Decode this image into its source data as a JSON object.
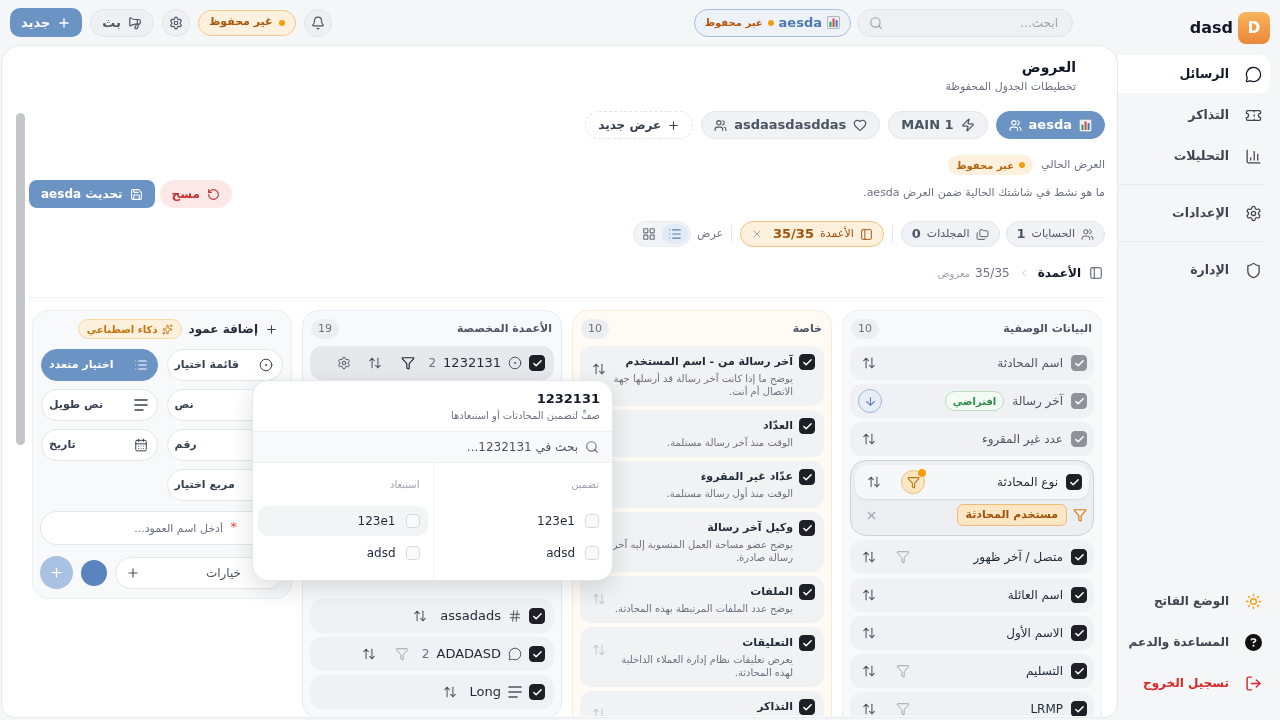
{
  "sidebar": {
    "brand": {
      "initial": "D",
      "name": "dasd"
    },
    "nav_groups": [
      {
        "items": [
          {
            "kind": "messages",
            "label": "الرسائل",
            "selected": true
          },
          {
            "kind": "tickets",
            "label": "التذاكر",
            "selected": false
          },
          {
            "kind": "analytics",
            "label": "التحليلات",
            "selected": false
          }
        ]
      },
      {
        "items": [
          {
            "kind": "settings",
            "label": "الإعدادات",
            "selected": false
          }
        ]
      },
      {
        "items": [
          {
            "kind": "admin",
            "label": "الإدارة",
            "selected": false
          }
        ]
      }
    ],
    "footer": [
      {
        "kind": "theme",
        "label": "الوضع الفاتح"
      },
      {
        "kind": "help",
        "label": "المساعدة والدعم"
      },
      {
        "kind": "logout",
        "label": "تسجيل الخروج"
      }
    ]
  },
  "topbar": {
    "search": {
      "placeholder": "ابحث..."
    },
    "view_chip": {
      "name": "aesda",
      "status": "غير محفوظ"
    },
    "status_badge": "غير محفوظ",
    "broadcast_button": "بث",
    "new_button": "جديد"
  },
  "views_panel": {
    "title": "العروض",
    "subtitle": "تخطيطات الجدول المحفوظة",
    "tabs": [
      {
        "kind": "chart",
        "label": "aesda",
        "shared": true,
        "selected": true
      },
      {
        "kind": "bolt",
        "label": "MAIN 1",
        "shared": false,
        "selected": false
      },
      {
        "kind": "heart",
        "label": "asdaasdasddas",
        "shared": true,
        "selected": false
      }
    ],
    "new_view_button": "عرض جديد",
    "current_view": {
      "label": "العرض الحالي",
      "status": "غير محفوظ",
      "description": "ما هو نشط في شاشتك الحالية ضمن العرض aesda.",
      "reset_button": "مسح",
      "update_button": "تحديث aesda"
    },
    "filters": [
      {
        "kind": "accounts",
        "label": "الحسابات",
        "count": "1",
        "active": false
      },
      {
        "kind": "folders",
        "label": "المجلدات",
        "count": "0",
        "active": false
      },
      {
        "kind": "columns",
        "label": "الأعمدة",
        "count": "35/35",
        "active": true
      }
    ],
    "display": {
      "label": "عرض",
      "modes": [
        {
          "kind": "list",
          "selected": true
        },
        {
          "kind": "grid",
          "selected": false
        }
      ]
    },
    "breadcrumb": {
      "title": "الأعمدة",
      "count": "35/35",
      "suffix": "معروض"
    },
    "groups": [
      {
        "kind": "metadata",
        "title": "البيانات الوصفية",
        "count": "10",
        "rows": [
          {
            "label": "اسم المحادثة",
            "checked": true,
            "disabled": true,
            "expanded": false,
            "filterable": false,
            "sortable": true,
            "sort_active": false
          },
          {
            "label": "آخر رسالة",
            "checked": true,
            "disabled": true,
            "expanded": false,
            "badge": "افتراضي",
            "filterable": false,
            "sortable": true,
            "sort_active": true
          },
          {
            "label": "عدد غير المقروء",
            "checked": true,
            "disabled": true,
            "expanded": false,
            "filterable": false,
            "sortable": true,
            "sort_active": false
          },
          {
            "label": "نوع المحادثة",
            "checked": true,
            "disabled": false,
            "expanded": true,
            "filterable": true,
            "filter_active": true,
            "sortable": true,
            "sort_active": false,
            "filter_values": [
              "مستخدم المحادثة"
            ]
          },
          {
            "label": "متصل / آخر ظهور",
            "checked": true,
            "disabled": false,
            "expanded": false,
            "filterable": true,
            "filter_active": false,
            "sortable": true,
            "sort_active": false
          },
          {
            "label": "اسم العائلة",
            "checked": true,
            "disabled": false,
            "expanded": false,
            "filterable": false,
            "sortable": true,
            "sort_active": false
          },
          {
            "label": "الاسم الأول",
            "checked": true,
            "disabled": false,
            "expanded": false,
            "filterable": false,
            "sortable": true,
            "sort_active": false
          },
          {
            "label": "التسليم",
            "checked": true,
            "disabled": false,
            "expanded": false,
            "filterable": true,
            "filter_active": false,
            "sortable": true,
            "sort_active": false
          },
          {
            "label": "LRMP",
            "checked": true,
            "disabled": false,
            "expanded": false,
            "filterable": true,
            "filter_active": false,
            "sortable": true,
            "sort_active": false
          }
        ]
      },
      {
        "kind": "special",
        "title": "خاصة",
        "count": "10",
        "rows": [
          {
            "title": "آخر رسالة من - اسم المستخدم",
            "description": "يوضح ما إذا كانت آخر رسالة قد أرسلها جهة الاتصال أم أنت.",
            "checked": true,
            "sortable": true,
            "sort_disabled": false
          },
          {
            "title": "العدّاد",
            "description": "الوقت منذ آخر رسالة مستلمة.",
            "checked": true
          },
          {
            "title": "عدّاد غير المقروء",
            "description": "الوقت منذ أول رسالة مستلمة.",
            "checked": true
          },
          {
            "title": "وكيل آخر رسالة",
            "description": "يوضح عضو مساحة العمل المنسوبة إليه آخر رسالة صادرة.",
            "checked": true
          },
          {
            "title": "الملفات",
            "description": "يوضح عدد الملفات المرتبطة بهذه المحادثة.",
            "checked": true,
            "sortable": true,
            "sort_disabled": true
          },
          {
            "title": "التعليقات",
            "description": "يعرض تعليقات نظام إدارة العملاء الداخلية لهذه المحادثة.",
            "checked": true,
            "sortable": true,
            "sort_disabled": true
          },
          {
            "title": "التذاكر",
            "checked": true,
            "sortable": true,
            "sort_disabled": true
          }
        ]
      },
      {
        "kind": "custom",
        "title": "الأعمدة المخصصة",
        "count": "19",
        "rows": [
          {
            "kind": "select",
            "label": "1232131",
            "checked": true,
            "selected": true,
            "filter_count": "2",
            "filterable": true,
            "filter_open": true
          },
          {
            "kind": "number",
            "label": "assadads",
            "checked": true,
            "selected": false,
            "filterable": false
          },
          {
            "kind": "comment",
            "label": "ADADASD",
            "checked": true,
            "selected": false,
            "filter_count": "2",
            "filterable": true,
            "filter_open": false
          },
          {
            "kind": "longtext",
            "label": "Long",
            "checked": true,
            "selected": false,
            "filterable": false
          }
        ]
      }
    ],
    "add_column": {
      "title": "إضافة عمود",
      "ai_button": "ذكاء اصطناعي",
      "types": [
        {
          "kind": "select",
          "label": "قائمة اختيار",
          "selected": false
        },
        {
          "kind": "multiselect",
          "label": "اختيار متعدد",
          "selected": true
        },
        {
          "kind": "text",
          "label": "نص",
          "selected": false
        },
        {
          "kind": "longtext",
          "label": "نص طويل",
          "selected": false
        },
        {
          "kind": "number",
          "label": "رقم",
          "selected": false
        },
        {
          "kind": "date",
          "label": "تاريخ",
          "selected": false
        },
        {
          "kind": "checkbox",
          "label": "مربع اختيار",
          "selected": false
        }
      ],
      "name_field": {
        "placeholder": "أدخل اسم العمود...",
        "required_mark": "*"
      },
      "options_field": {
        "placeholder": "خيارات"
      },
      "color": "#5a84bf"
    },
    "filter_popover": {
      "title": "1232131",
      "subtitle": "صفِّ لتضمين المحادثات أو استبعادها",
      "search": {
        "placeholder": "بحث في 1232131..."
      },
      "columns": [
        {
          "label": "تضمين",
          "options": [
            {
              "label": "123e1",
              "checked": false,
              "highlighted": false
            },
            {
              "label": "adsd",
              "checked": false,
              "highlighted": false
            }
          ]
        },
        {
          "label": "استبعاد",
          "options": [
            {
              "label": "123e1",
              "checked": false,
              "highlighted": true
            },
            {
              "label": "adsd",
              "checked": false,
              "highlighted": false
            }
          ]
        }
      ]
    }
  }
}
